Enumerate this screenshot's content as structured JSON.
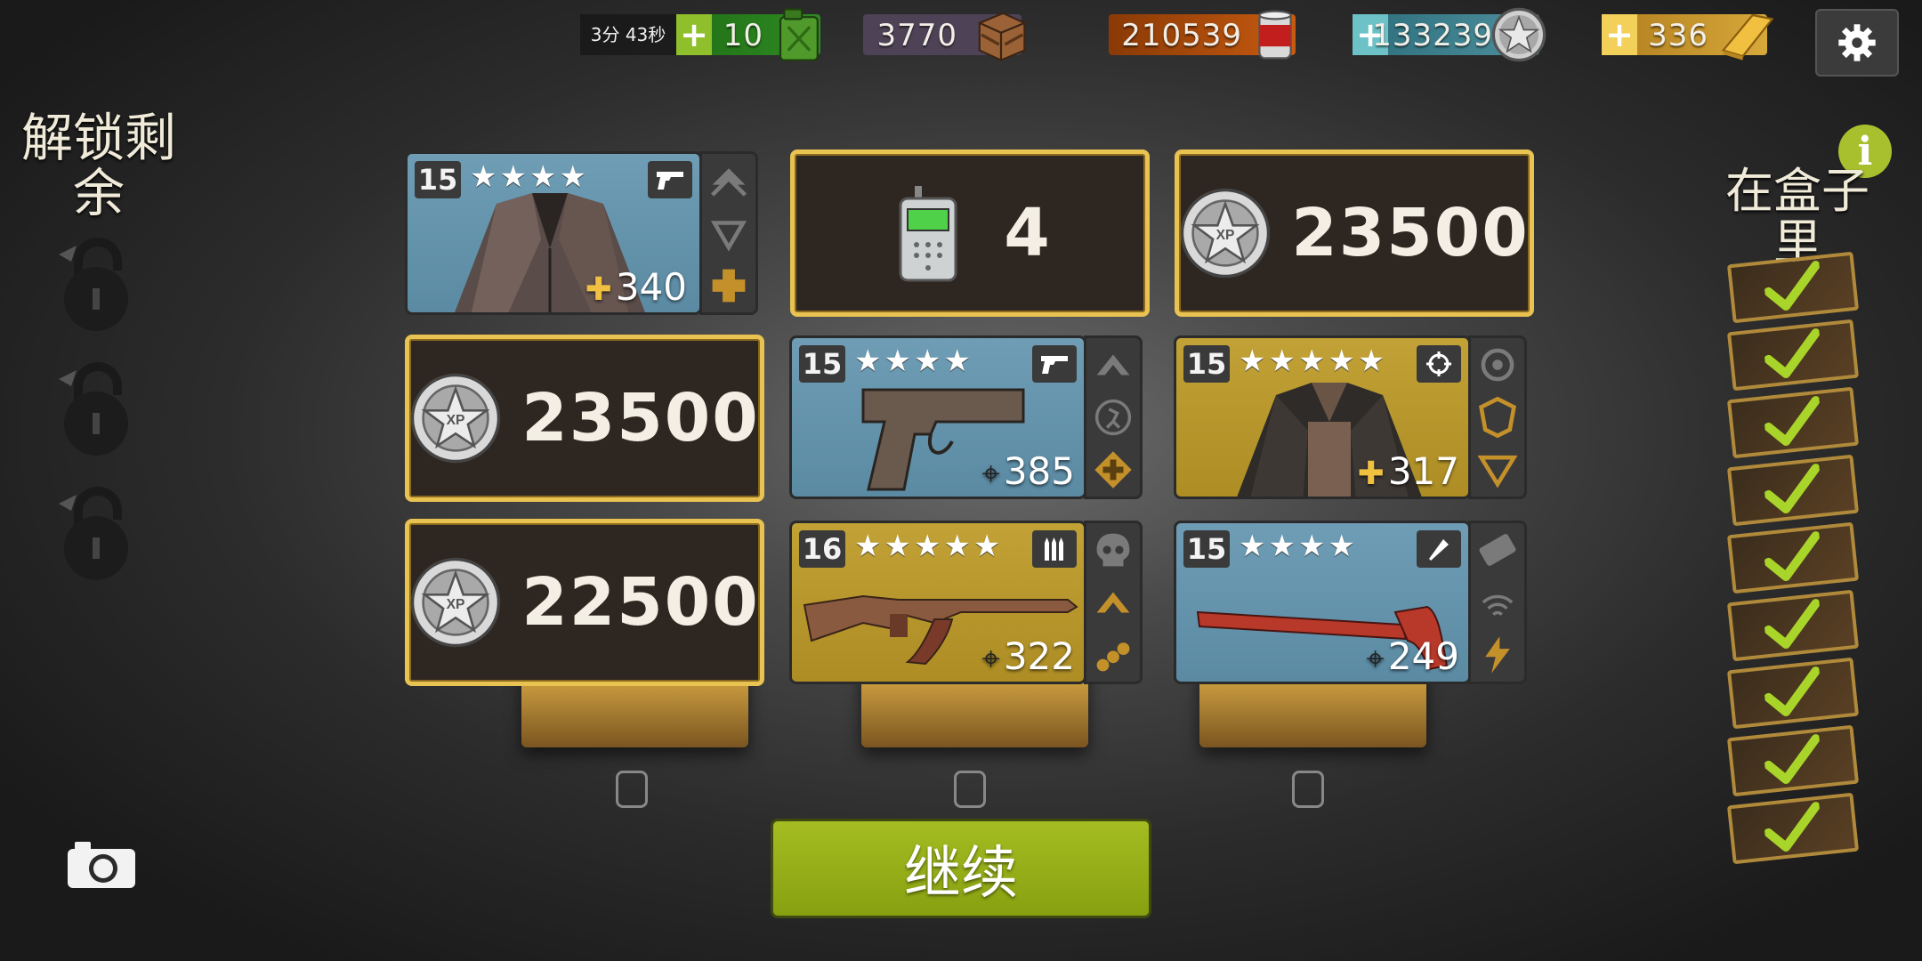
{
  "top_bar": {
    "timer": "3分 43秒",
    "energy": {
      "value": "10",
      "icon": "fuel-can-icon",
      "color": "#2f8a22"
    },
    "crates": {
      "value": "3770",
      "icon": "crate-icon",
      "color": "#4e4356"
    },
    "food": {
      "value": "210539",
      "icon": "food-can-icon",
      "color": "#b8530c"
    },
    "xp": {
      "value": "133239",
      "icon": "xp-star-icon",
      "color": "#4a8a9a"
    },
    "gold": {
      "value": "336",
      "icon": "gold-bar-icon",
      "color": "#c99a2a"
    },
    "settings_icon": "gear-icon"
  },
  "left_panel": {
    "title": "解锁剩余",
    "locks": [
      "lock-icon",
      "lock-icon",
      "lock-icon"
    ],
    "camera_icon": "camera-icon"
  },
  "right_panel": {
    "title": "在盒子里",
    "info_label": "i",
    "checks": 9
  },
  "cards": [
    {
      "kind": "item",
      "level": "15",
      "stars": "★★★★",
      "rarity": "blue",
      "type_icon": "pistol-icon",
      "stat": "340",
      "stat_icon": "health-cross-icon",
      "image": "leather-jacket",
      "perks": [
        "arrow-perk-icon",
        "chevron-perk-icon",
        "health-boost-perk-icon"
      ]
    },
    {
      "kind": "radio",
      "value": "4",
      "icon": "walkie-talkie-icon"
    },
    {
      "kind": "xp",
      "value": "23500",
      "icon": "xp-star-icon"
    },
    {
      "kind": "xp",
      "value": "23500",
      "icon": "xp-star-icon"
    },
    {
      "kind": "item",
      "level": "15",
      "stars": "★★★★",
      "rarity": "blue",
      "type_icon": "pistol-icon",
      "stat": "385",
      "stat_icon": "crosshair-icon",
      "image": "pistol",
      "perks": [
        "fire-rate-perk-icon",
        "runner-perk-icon",
        "health-boost-perk-icon"
      ]
    },
    {
      "kind": "item",
      "level": "15",
      "stars": "★★★★★",
      "rarity": "yellow",
      "type_icon": "crosshair-icon",
      "stat": "317",
      "stat_icon": "health-cross-icon",
      "image": "vest-jacket",
      "perks": [
        "target-perk-icon",
        "shield-perk-icon",
        "speed-perk-icon"
      ]
    },
    {
      "kind": "xp",
      "value": "22500",
      "icon": "xp-star-icon"
    },
    {
      "kind": "item",
      "level": "16",
      "stars": "★★★★★",
      "rarity": "yellow",
      "type_icon": "ammo-icon",
      "stat": "322",
      "stat_icon": "crosshair-icon",
      "image": "assault-rifle",
      "perks": [
        "skull-perk-icon",
        "fire-rate-perk-icon",
        "ammo-belt-perk-icon"
      ]
    },
    {
      "kind": "item",
      "level": "15",
      "stars": "★★★★",
      "rarity": "blue",
      "type_icon": "melee-icon",
      "stat": "249",
      "stat_icon": "crosshair-icon",
      "image": "pipe-wrench",
      "perks": [
        "blade-perk-icon",
        "signal-perk-icon",
        "lightning-perk-icon"
      ]
    }
  ],
  "continue_label": "继续"
}
